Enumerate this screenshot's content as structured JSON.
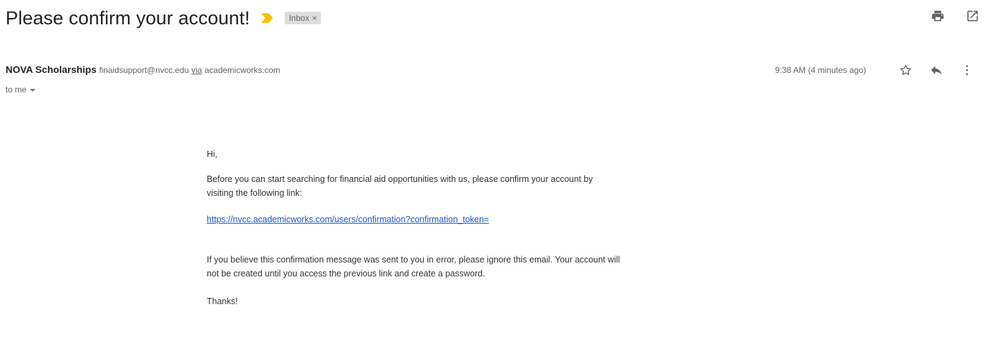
{
  "email": {
    "subject": "Please confirm your account!",
    "label": "Inbox",
    "label_close": "×",
    "sender_name": "NOVA Scholarships",
    "sender_email": "finaidsupport@nvcc.edu",
    "via": "via",
    "via_domain": "academicworks.com",
    "recipient": "to me",
    "timestamp": "9:38 AM (4 minutes ago)"
  },
  "body": {
    "greeting": "Hi,",
    "paragraph1": "Before you can start searching for financial aid opportunities with us, please confirm your account by visiting the following link:",
    "link": "https://nvcc.academicworks.com/users/confirmation?confirmation_token=",
    "paragraph2": "If you believe this confirmation message was sent to you in error, please ignore this email. Your account will not be created until you access the previous link and create a password.",
    "closing": "Thanks!"
  },
  "icons": {
    "importance": "importance-marker-icon",
    "print": "print-icon",
    "open_new_window": "open-in-new-window-icon",
    "star": "star-icon",
    "reply": "reply-icon",
    "more": "more-vertical-icon"
  },
  "colors": {
    "importance": "#f4c20d",
    "link": "#1a56c8",
    "label_bg": "#dddddd"
  }
}
